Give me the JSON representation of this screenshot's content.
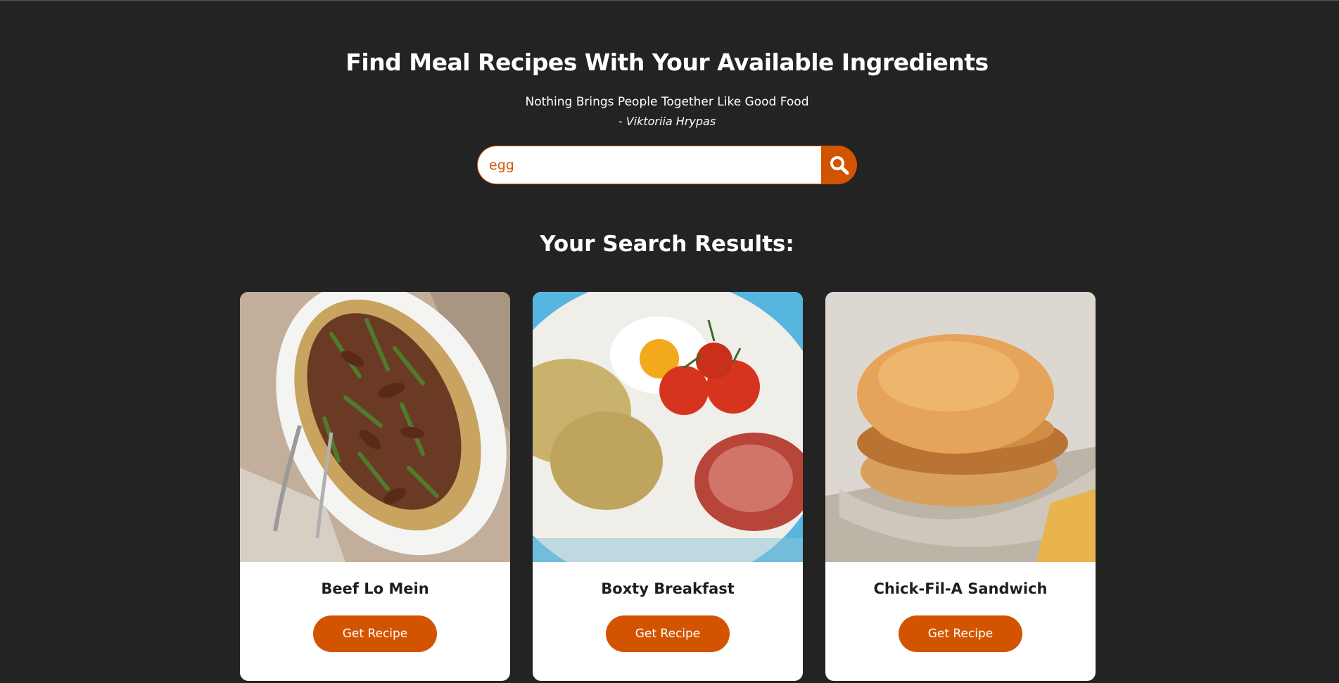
{
  "header": {
    "title": "Find Meal Recipes With Your Available Ingredients",
    "quote": "Nothing Brings People Together Like Good Food",
    "author": "- Viktoriia Hrypas"
  },
  "search": {
    "value": "egg",
    "icon": "search-icon"
  },
  "results": {
    "title": "Your Search Results:",
    "items": [
      {
        "name": "Beef Lo Mein",
        "button_label": "Get Recipe"
      },
      {
        "name": "Boxty Breakfast",
        "button_label": "Get Recipe"
      },
      {
        "name": "Chick-Fil-A Sandwich",
        "button_label": "Get Recipe"
      }
    ]
  },
  "colors": {
    "background": "#232323",
    "accent": "#d35400",
    "card": "#ffffff"
  }
}
